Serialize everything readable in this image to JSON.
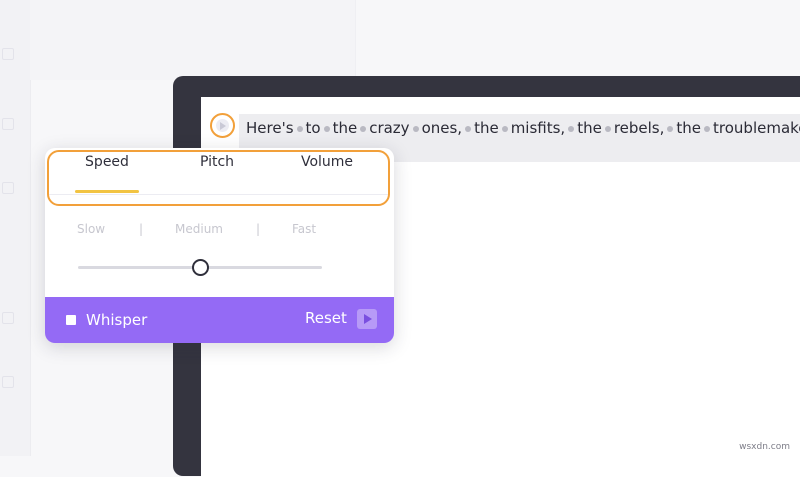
{
  "sentence": {
    "words": [
      "Here's",
      "to",
      "the",
      "crazy",
      "ones,",
      "the",
      "misfits,",
      "the",
      "rebels,",
      "the",
      "troublemakers"
    ]
  },
  "voice_popup": {
    "tabs": [
      {
        "label": "Speed",
        "active": true
      },
      {
        "label": "Pitch",
        "active": false
      },
      {
        "label": "Volume",
        "active": false
      }
    ],
    "speed_options": [
      "Slow",
      "|",
      "Medium",
      "|",
      "Fast"
    ],
    "slider_value": 0.5,
    "whisper_label": "Whisper",
    "whisper_checked": false,
    "reset_label": "Reset"
  },
  "watermark": "wsxdn.com",
  "colors": {
    "accent_orange": "#f2a03a",
    "footer_purple": "#946af5",
    "frame_dark": "#34343f",
    "underline_yellow": "#f2c443"
  }
}
